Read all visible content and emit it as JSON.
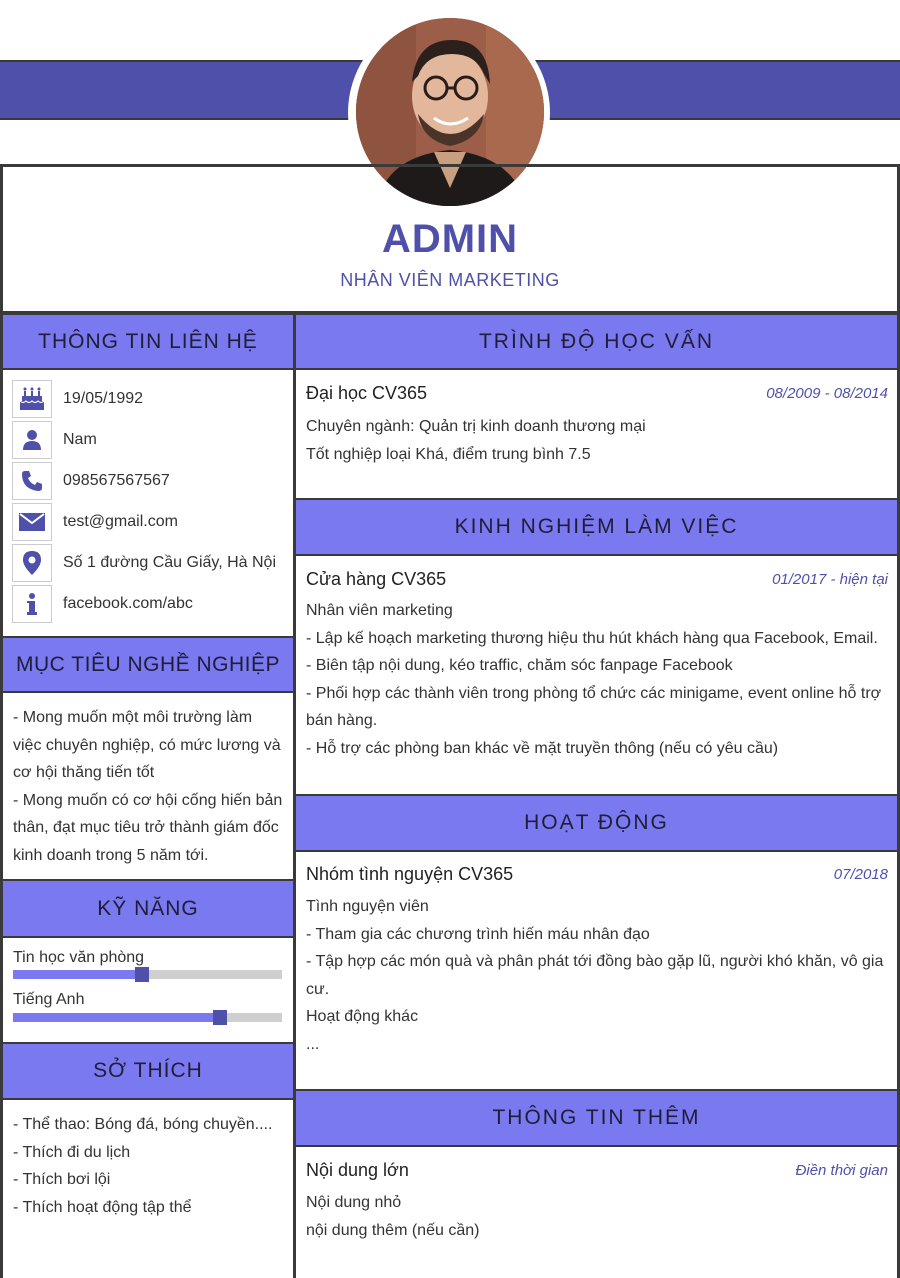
{
  "header": {
    "name": "ADMIN",
    "role": "NHÂN VIÊN MARKETING"
  },
  "colors": {
    "accent_dark": "#4f50a9",
    "accent_light": "#7a79ef",
    "border": "#3a3a3a"
  },
  "contact": {
    "title": "THÔNG TIN LIÊN HỆ",
    "items": [
      {
        "icon": "birthday-cake-icon",
        "text": "19/05/1992"
      },
      {
        "icon": "person-icon",
        "text": "Nam"
      },
      {
        "icon": "phone-icon",
        "text": "098567567567"
      },
      {
        "icon": "envelope-icon",
        "text": "test@gmail.com"
      },
      {
        "icon": "map-pin-icon",
        "text": "Số 1 đường Cầu Giấy, Hà Nội"
      },
      {
        "icon": "info-icon",
        "text": "facebook.com/abc"
      }
    ]
  },
  "objective": {
    "title": "MỤC TIÊU NGHỀ NGHIỆP",
    "lines": [
      "- Mong muốn một môi trường làm",
      "việc chuyên nghiệp, có mức lương và",
      "cơ hội thăng tiến tốt",
      "- Mong muốn có cơ hội cống hiến bản",
      "thân, đạt mục tiêu trở thành giám đốc",
      "kinh doanh trong 5 năm tới."
    ]
  },
  "skills": {
    "title": "KỸ NĂNG",
    "items": [
      {
        "name": "Tin học văn phòng",
        "level": 0.48
      },
      {
        "name": "Tiếng Anh",
        "level": 0.77
      }
    ]
  },
  "hobbies": {
    "title": "SỞ THÍCH",
    "lines": [
      "- Thể thao: Bóng đá, bóng chuyền....",
      "- Thích đi du lịch",
      "- Thích bơi lội",
      "- Thích hoạt động tập thể"
    ]
  },
  "education": {
    "title": "TRÌNH ĐỘ HỌC VẤN",
    "school": "Đại học CV365",
    "period": "08/2009 - 08/2014",
    "lines": [
      "Chuyên ngành: Quản trị kinh doanh thương mại",
      "Tốt nghiệp loại Khá, điểm trung bình 7.5"
    ]
  },
  "experience": {
    "title": "KINH NGHIỆM LÀM VIỆC",
    "company": "Cửa hàng CV365",
    "period": "01/2017 - hiện tại",
    "lines": [
      "Nhân viên marketing",
      "- Lập kế hoạch marketing thương hiệu thu hút khách hàng qua Facebook, Email.",
      "- Biên tập nội dung, kéo traffic, chăm sóc fanpage Facebook",
      "- Phối hợp các thành viên trong phòng tổ chức các minigame, event online hỗ trợ",
      "bán hàng.",
      "- Hỗ trợ các phòng ban khác về mặt truyền thông (nếu có yêu cầu)"
    ]
  },
  "activities": {
    "title": "HOẠT ĐỘNG",
    "group": "Nhóm tình nguyện CV365",
    "period": "07/2018",
    "lines": [
      "Tình nguyện viên",
      "- Tham gia các chương trình hiến máu nhân đạo",
      "- Tập hợp các món quà và phân phát tới đồng bào gặp lũ, người khó khăn, vô gia",
      "cư.",
      "Hoạt động khác",
      "..."
    ]
  },
  "more_info": {
    "title": "THÔNG  TIN  THÊM",
    "heading": "Nội dung lớn",
    "period": "Điền thời gian",
    "lines": [
      "Nội dung nhỏ",
      "nội dung thêm (nếu cần)"
    ]
  }
}
